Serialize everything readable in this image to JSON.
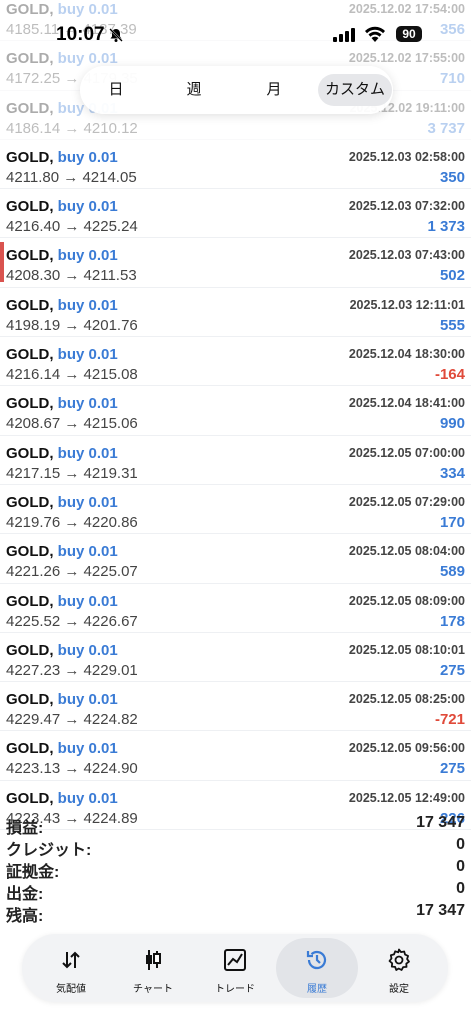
{
  "status_bar": {
    "time": "10:07",
    "battery": "90"
  },
  "tabs": [
    {
      "label": "日"
    },
    {
      "label": "週"
    },
    {
      "label": "月"
    },
    {
      "label": "カスタム"
    }
  ],
  "trades": [
    {
      "symbol": "GOLD,",
      "side": "buy 0.01",
      "date": "2025.12.02 17:54:00",
      "price": "4185.11 → 4187.39",
      "profit": "356"
    },
    {
      "symbol": "GOLD,",
      "side": "buy 0.01",
      "date": "2025.12.02 17:55:00",
      "price": "4172.25 → 4179.35",
      "profit": "710"
    },
    {
      "symbol": "GOLD,",
      "side": "buy 0.01",
      "date": "2025.12.02 19:11:00",
      "price": "4186.14 → 4210.12",
      "profit": "3 737"
    },
    {
      "symbol": "GOLD,",
      "side": "buy 0.01",
      "date": "2025.12.03 02:58:00",
      "price": "4211.80 → 4214.05",
      "profit": "350"
    },
    {
      "symbol": "GOLD,",
      "side": "buy 0.01",
      "date": "2025.12.03 07:32:00",
      "price": "4216.40 → 4225.24",
      "profit": "1 373"
    },
    {
      "symbol": "GOLD,",
      "side": "buy 0.01",
      "date": "2025.12.03 07:43:00",
      "price": "4208.30 → 4211.53",
      "profit": "502",
      "marked": true
    },
    {
      "symbol": "GOLD,",
      "side": "buy 0.01",
      "date": "2025.12.03 12:11:01",
      "price": "4198.19 → 4201.76",
      "profit": "555"
    },
    {
      "symbol": "GOLD,",
      "side": "buy 0.01",
      "date": "2025.12.04 18:30:00",
      "price": "4216.14 → 4215.08",
      "profit": "-164",
      "negative": true
    },
    {
      "symbol": "GOLD,",
      "side": "buy 0.01",
      "date": "2025.12.04 18:41:00",
      "price": "4208.67 → 4215.06",
      "profit": "990"
    },
    {
      "symbol": "GOLD,",
      "side": "buy 0.01",
      "date": "2025.12.05 07:00:00",
      "price": "4217.15 → 4219.31",
      "profit": "334"
    },
    {
      "symbol": "GOLD,",
      "side": "buy 0.01",
      "date": "2025.12.05 07:29:00",
      "price": "4219.76 → 4220.86",
      "profit": "170"
    },
    {
      "symbol": "GOLD,",
      "side": "buy 0.01",
      "date": "2025.12.05 08:04:00",
      "price": "4221.26 → 4225.07",
      "profit": "589"
    },
    {
      "symbol": "GOLD,",
      "side": "buy 0.01",
      "date": "2025.12.05 08:09:00",
      "price": "4225.52 → 4226.67",
      "profit": "178"
    },
    {
      "symbol": "GOLD,",
      "side": "buy 0.01",
      "date": "2025.12.05 08:10:01",
      "price": "4227.23 → 4229.01",
      "profit": "275"
    },
    {
      "symbol": "GOLD,",
      "side": "buy 0.01",
      "date": "2025.12.05 08:25:00",
      "price": "4229.47 → 4224.82",
      "profit": "-721",
      "negative": true
    },
    {
      "symbol": "GOLD,",
      "side": "buy 0.01",
      "date": "2025.12.05 09:56:00",
      "price": "4223.13 → 4224.90",
      "profit": "275"
    },
    {
      "symbol": "GOLD,",
      "side": "buy 0.01",
      "date": "2025.12.05 12:49:00",
      "price": "4223.43 → 4224.89",
      "profit": "226"
    }
  ],
  "summary": [
    {
      "label": "損益:",
      "value": "17 347"
    },
    {
      "label": "クレジット:",
      "value": "0"
    },
    {
      "label": "証拠金:",
      "value": "0"
    },
    {
      "label": "出金:",
      "value": "0"
    },
    {
      "label": "残高:",
      "value": "17 347"
    }
  ],
  "nav": [
    {
      "label": "気配値",
      "icon": "arrows-updown-icon"
    },
    {
      "label": "チャート",
      "icon": "candlestick-icon"
    },
    {
      "label": "トレード",
      "icon": "line-chart-icon"
    },
    {
      "label": "履歴",
      "icon": "history-clock-icon",
      "active": true
    },
    {
      "label": "設定",
      "icon": "gear-icon"
    }
  ],
  "colors": {
    "accent": "#3a7bd5",
    "negative": "#e04a3a",
    "marker": "#d9534f"
  }
}
